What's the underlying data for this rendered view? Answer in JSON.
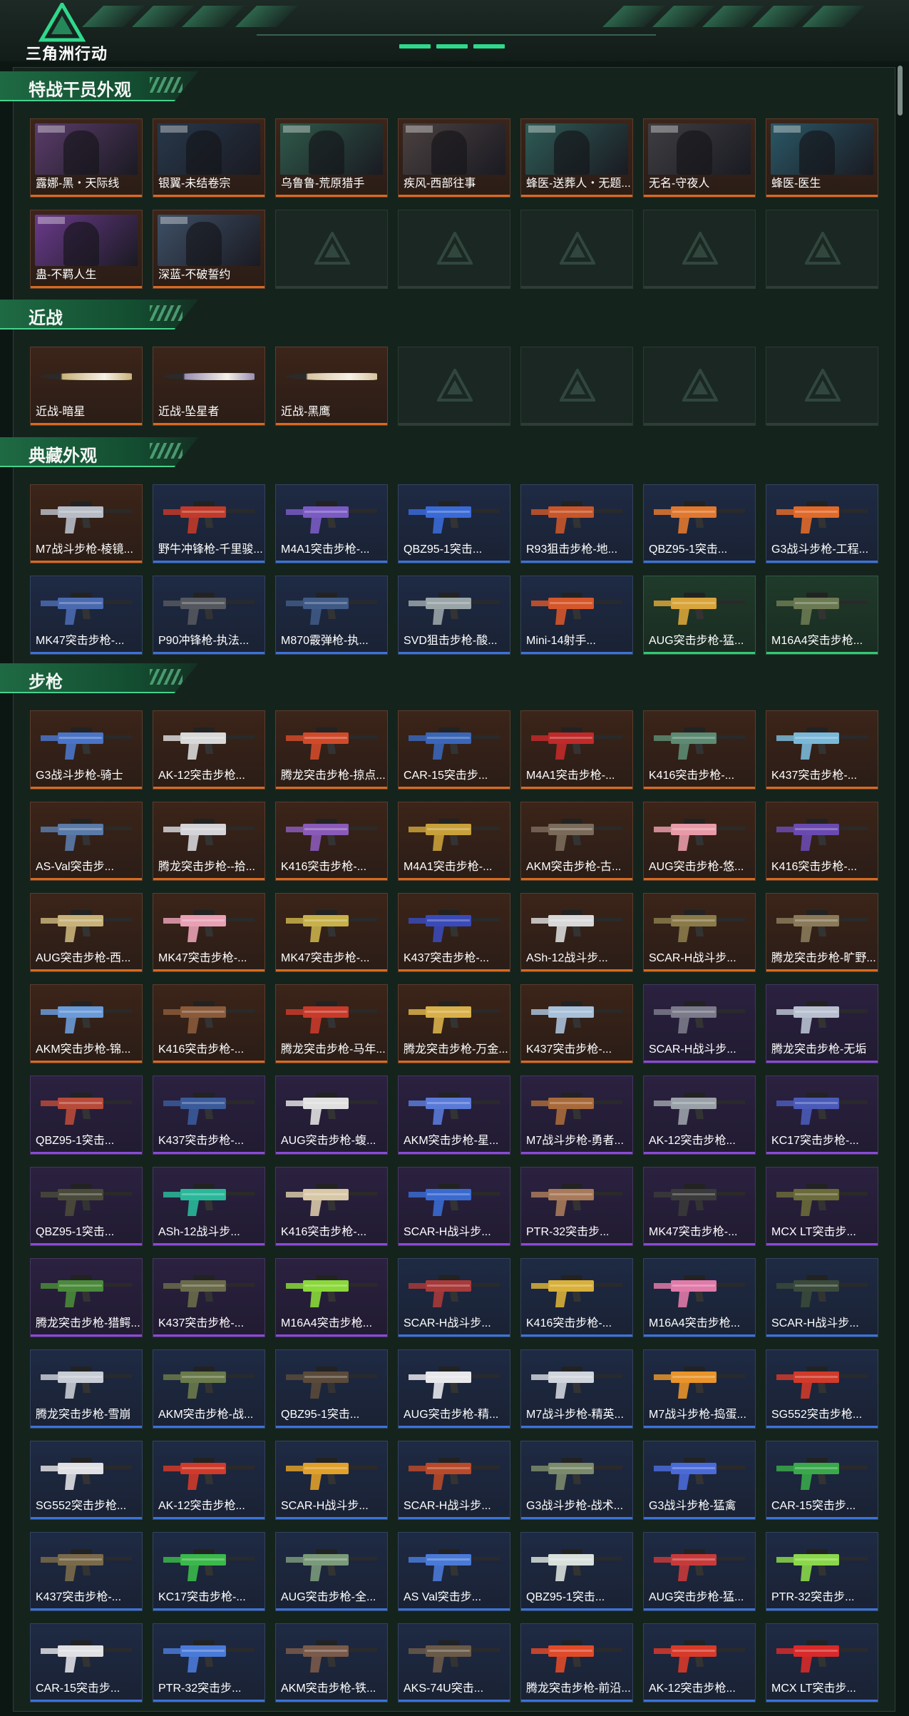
{
  "header": {
    "title": "三角洲行动"
  },
  "palette": {
    "orange": "#d86a1f",
    "blue": "#3b73d9",
    "purple": "#8a4ad6",
    "green": "#33c877",
    "accent": "#2fd98b"
  },
  "sections": [
    {
      "id": "operators",
      "title": "特战干员外观",
      "kind": "photo",
      "items": [
        {
          "label": "露娜-黑・天际线",
          "rarity": "orange",
          "art": "#5b3c6a"
        },
        {
          "label": "银翼-未结卷宗",
          "rarity": "orange",
          "art": "#27384a"
        },
        {
          "label": "乌鲁鲁-荒原猎手",
          "rarity": "orange",
          "art": "#2f5a4a"
        },
        {
          "label": "疾风-西部往事",
          "rarity": "orange",
          "art": "#4b4140"
        },
        {
          "label": "蜂医-送葬人・无题...",
          "rarity": "orange",
          "art": "#2e5c56"
        },
        {
          "label": "无名-守夜人",
          "rarity": "orange",
          "art": "#3e3e42"
        },
        {
          "label": "蜂医-医生",
          "rarity": "orange",
          "art": "#2a5866"
        },
        {
          "label": "蛊-不羁人生",
          "rarity": "orange",
          "art": "#6a3a8a"
        },
        {
          "label": "深蓝-不破誓约",
          "rarity": "orange",
          "art": "#3e5066"
        },
        {
          "label": "",
          "rarity": "empty"
        },
        {
          "label": "",
          "rarity": "empty"
        },
        {
          "label": "",
          "rarity": "empty"
        },
        {
          "label": "",
          "rarity": "empty"
        },
        {
          "label": "",
          "rarity": "empty"
        }
      ]
    },
    {
      "id": "melee",
      "title": "近战",
      "kind": "blade",
      "items": [
        {
          "label": "近战-暗星",
          "rarity": "orange",
          "art": "#c9b27a"
        },
        {
          "label": "近战-坠星者",
          "rarity": "orange",
          "art": "#9a8fb4"
        },
        {
          "label": "近战-黑鹰",
          "rarity": "orange",
          "art": "#d6c3a0"
        },
        {
          "label": "",
          "rarity": "empty"
        },
        {
          "label": "",
          "rarity": "empty"
        },
        {
          "label": "",
          "rarity": "empty"
        },
        {
          "label": "",
          "rarity": "empty"
        }
      ]
    },
    {
      "id": "collection",
      "title": "典藏外观",
      "kind": "gun",
      "items": [
        {
          "label": "M7战斗步枪-棱镜...",
          "rarity": "orange",
          "art": "#b7bcc6"
        },
        {
          "label": "野牛冲锋枪-千里骏...",
          "rarity": "blue",
          "art": "#c23a2a"
        },
        {
          "label": "M4A1突击步枪-...",
          "rarity": "blue",
          "art": "#7a5bc4"
        },
        {
          "label": "QBZ95-1突击...",
          "rarity": "blue",
          "art": "#3a6ad6"
        },
        {
          "label": "R93狙击步枪-地...",
          "rarity": "blue",
          "art": "#c8562a"
        },
        {
          "label": "QBZ95-1突击...",
          "rarity": "blue",
          "art": "#e0782f"
        },
        {
          "label": "G3战斗步枪-工程...",
          "rarity": "blue",
          "art": "#e06a2a"
        },
        {
          "label": "MK47突击步枪-...",
          "rarity": "blue",
          "art": "#4a6ab0"
        },
        {
          "label": "P90冲锋枪-执法...",
          "rarity": "blue",
          "art": "#55585e"
        },
        {
          "label": "M870霰弹枪-执...",
          "rarity": "blue",
          "art": "#3f5a86"
        },
        {
          "label": "SVD狙击步枪-酸...",
          "rarity": "blue",
          "art": "#9aa5a8"
        },
        {
          "label": "Mini-14射手...",
          "rarity": "blue",
          "art": "#d4562a"
        },
        {
          "label": "AUG突击步枪-猛...",
          "rarity": "green",
          "art": "#d9a43a"
        },
        {
          "label": "M16A4突击步枪...",
          "rarity": "green",
          "art": "#6b7a52"
        }
      ]
    },
    {
      "id": "rifles",
      "title": "步枪",
      "kind": "gun",
      "items": [
        {
          "label": "G3战斗步枪-骑士",
          "rarity": "orange",
          "art": "#4a74c8"
        },
        {
          "label": "AK-12突击步枪...",
          "rarity": "orange",
          "art": "#d8d8d8"
        },
        {
          "label": "腾龙突击步枪-掠点...",
          "rarity": "orange",
          "art": "#d04a2a"
        },
        {
          "label": "CAR-15突击步...",
          "rarity": "orange",
          "art": "#3a66b8"
        },
        {
          "label": "M4A1突击步枪-...",
          "rarity": "orange",
          "art": "#c02a2a"
        },
        {
          "label": "K416突击步枪-...",
          "rarity": "orange",
          "art": "#5c8a72"
        },
        {
          "label": "K437突击步枪-...",
          "rarity": "orange",
          "art": "#7ab8d8"
        },
        {
          "label": "AS-Val突击步...",
          "rarity": "orange",
          "art": "#5a7aa8"
        },
        {
          "label": "腾龙突击步枪--拾...",
          "rarity": "orange",
          "art": "#d4d4d8"
        },
        {
          "label": "K416突击步枪-...",
          "rarity": "orange",
          "art": "#8a5ab8"
        },
        {
          "label": "M4A1突击步枪-...",
          "rarity": "orange",
          "art": "#c8a03a"
        },
        {
          "label": "AKM突击步枪-古...",
          "rarity": "orange",
          "art": "#7a6a5a"
        },
        {
          "label": "AUG突击步枪-悠...",
          "rarity": "orange",
          "art": "#e89aa8"
        },
        {
          "label": "K416突击步枪-...",
          "rarity": "orange",
          "art": "#6a4ab0"
        },
        {
          "label": "AUG突击步枪-西...",
          "rarity": "orange",
          "art": "#c8b27a"
        },
        {
          "label": "MK47突击步枪-...",
          "rarity": "orange",
          "art": "#e8a0b4"
        },
        {
          "label": "MK47突击步枪-...",
          "rarity": "orange",
          "art": "#c8b04a"
        },
        {
          "label": "K437突击步枪-...",
          "rarity": "orange",
          "art": "#3a4ab8"
        },
        {
          "label": "ASh-12战斗步...",
          "rarity": "orange",
          "art": "#d8d8d8"
        },
        {
          "label": "SCAR-H战斗步...",
          "rarity": "orange",
          "art": "#8a7a4a"
        },
        {
          "label": "腾龙突击步枪-旷野...",
          "rarity": "orange",
          "art": "#8a7a5a"
        },
        {
          "label": "AKM突击步枪-锦...",
          "rarity": "orange",
          "art": "#6a9ad8"
        },
        {
          "label": "K416突击步枪-...",
          "rarity": "orange",
          "art": "#8a5a3a"
        },
        {
          "label": "腾龙突击步枪-马年...",
          "rarity": "orange",
          "art": "#c83a2a"
        },
        {
          "label": "腾龙突击步枪-万金...",
          "rarity": "orange",
          "art": "#d8b04a"
        },
        {
          "label": "K437突击步枪-...",
          "rarity": "orange",
          "art": "#a8c0d8"
        },
        {
          "label": "SCAR-H战斗步...",
          "rarity": "purple",
          "art": "#7a7a8a"
        },
        {
          "label": "腾龙突击步枪-无垢",
          "rarity": "purple",
          "art": "#b8c0d0"
        },
        {
          "label": "QBZ95-1突击...",
          "rarity": "purple",
          "art": "#b84a3a"
        },
        {
          "label": "K437突击步枪-...",
          "rarity": "purple",
          "art": "#3a5a9a"
        },
        {
          "label": "AUG突击步枪-蝮...",
          "rarity": "purple",
          "art": "#e0e0e0"
        },
        {
          "label": "AKM突击步枪-星...",
          "rarity": "purple",
          "art": "#5a7ad8"
        },
        {
          "label": "M7战斗步枪-勇者...",
          "rarity": "purple",
          "art": "#a86a3a"
        },
        {
          "label": "AK-12突击步枪...",
          "rarity": "purple",
          "art": "#9aa0a8"
        },
        {
          "label": "KC17突击步枪-...",
          "rarity": "purple",
          "art": "#4a5ab8"
        },
        {
          "label": "QBZ95-1突击...",
          "rarity": "purple",
          "art": "#4a4a3a"
        },
        {
          "label": "ASh-12战斗步...",
          "rarity": "purple",
          "art": "#2ab89a"
        },
        {
          "label": "K416突击步枪-...",
          "rarity": "purple",
          "art": "#d8c8a8"
        },
        {
          "label": "SCAR-H战斗步...",
          "rarity": "purple",
          "art": "#3a6ad0"
        },
        {
          "label": "PTR-32突击步...",
          "rarity": "purple",
          "art": "#a87a5a"
        },
        {
          "label": "MK47突击步枪-...",
          "rarity": "purple",
          "art": "#3a3a3a"
        },
        {
          "label": "MCX LT突击步...",
          "rarity": "purple",
          "art": "#6a6a3a"
        },
        {
          "label": "腾龙突击步枪-猎鳄...",
          "rarity": "purple",
          "art": "#4a8a3a"
        },
        {
          "label": "K437突击步枪-...",
          "rarity": "purple",
          "art": "#6a6a4a"
        },
        {
          "label": "M16A4突击步枪...",
          "rarity": "purple",
          "art": "#8ad83a"
        },
        {
          "label": "SCAR-H战斗步...",
          "rarity": "blue",
          "art": "#a83a3a"
        },
        {
          "label": "K416突击步枪-...",
          "rarity": "blue",
          "art": "#d8b03a"
        },
        {
          "label": "M16A4突击步枪...",
          "rarity": "blue",
          "art": "#e07aa8"
        },
        {
          "label": "SCAR-H战斗步...",
          "rarity": "blue",
          "art": "#3a4a3a"
        },
        {
          "label": "腾龙突击步枪-雪崩",
          "rarity": "blue",
          "art": "#c8ccd4"
        },
        {
          "label": "AKM突击步枪-战...",
          "rarity": "blue",
          "art": "#6a7a4a"
        },
        {
          "label": "QBZ95-1突击...",
          "rarity": "blue",
          "art": "#5a4a3a"
        },
        {
          "label": "AUG突击步枪-精...",
          "rarity": "blue",
          "art": "#e8e8ec"
        },
        {
          "label": "M7战斗步枪-精英...",
          "rarity": "blue",
          "art": "#d0d4dc"
        },
        {
          "label": "M7战斗步枪-捣蛋...",
          "rarity": "blue",
          "art": "#e8942a"
        },
        {
          "label": "SG552突击步枪...",
          "rarity": "blue",
          "art": "#d03a2a"
        },
        {
          "label": "SG552突击步枪...",
          "rarity": "blue",
          "art": "#e0e0e4"
        },
        {
          "label": "AK-12突击步枪...",
          "rarity": "blue",
          "art": "#d03a2a"
        },
        {
          "label": "SCAR-H战斗步...",
          "rarity": "blue",
          "art": "#e0a02a"
        },
        {
          "label": "SCAR-H战斗步...",
          "rarity": "blue",
          "art": "#b84a2a"
        },
        {
          "label": "G3战斗步枪-战术...",
          "rarity": "blue",
          "art": "#7a8a6a"
        },
        {
          "label": "G3战斗步枪-猛禽",
          "rarity": "blue",
          "art": "#4a6ad8"
        },
        {
          "label": "CAR-15突击步...",
          "rarity": "blue",
          "art": "#3aa84a"
        },
        {
          "label": "K437突击步枪-...",
          "rarity": "blue",
          "art": "#7a6a4a"
        },
        {
          "label": "KC17突击步枪-...",
          "rarity": "blue",
          "art": "#3ab84a"
        },
        {
          "label": "AUG突击步枪-全...",
          "rarity": "blue",
          "art": "#7a9a7a"
        },
        {
          "label": "AS Val突击步...",
          "rarity": "blue",
          "art": "#4a7ad8"
        },
        {
          "label": "QBZ95-1突击...",
          "rarity": "blue",
          "art": "#d8e0dc"
        },
        {
          "label": "AUG突击步枪-猛...",
          "rarity": "blue",
          "art": "#c83a3a"
        },
        {
          "label": "PTR-32突击步...",
          "rarity": "blue",
          "art": "#8ad84a"
        },
        {
          "label": "CAR-15突击步...",
          "rarity": "blue",
          "art": "#e0e0e4"
        },
        {
          "label": "PTR-32突击步...",
          "rarity": "blue",
          "art": "#4a7ad8"
        },
        {
          "label": "AKM突击步枪-铁...",
          "rarity": "blue",
          "art": "#7a5a4a"
        },
        {
          "label": "AKS-74U突击...",
          "rarity": "blue",
          "art": "#6a5a4a"
        },
        {
          "label": "腾龙突击步枪-前沿...",
          "rarity": "blue",
          "art": "#e04a2a"
        },
        {
          "label": "AK-12突击步枪...",
          "rarity": "blue",
          "art": "#d83a2a"
        },
        {
          "label": "MCX LT突击步...",
          "rarity": "blue",
          "art": "#d82a2a"
        }
      ]
    }
  ]
}
